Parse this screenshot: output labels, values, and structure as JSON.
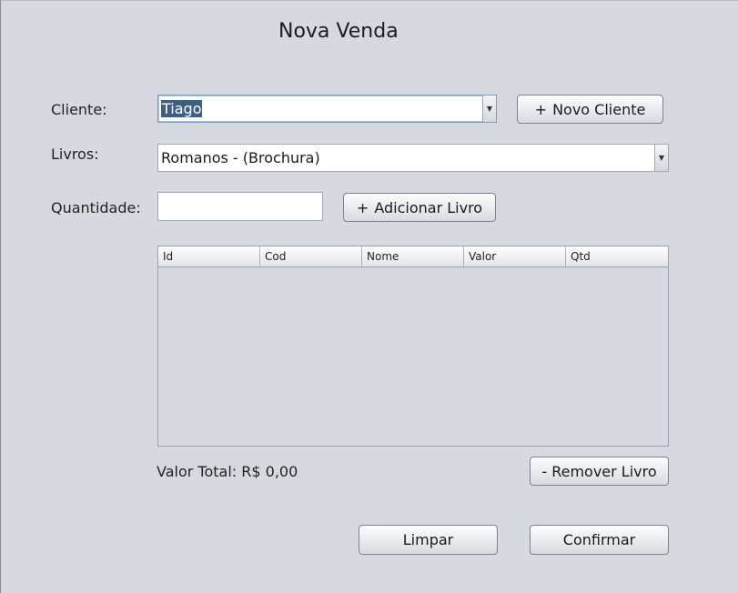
{
  "window": {
    "title": "Nova Venda"
  },
  "cliente": {
    "label": "Cliente:",
    "selected": "Tiago",
    "new_button": "Novo Cliente"
  },
  "livros": {
    "label": "Livros:",
    "selected": "Romanos - (Brochura)"
  },
  "quantidade": {
    "label": "Quantidade:",
    "value": "",
    "add_button": "Adicionar Livro"
  },
  "table": {
    "columns": [
      "Id",
      "Cod",
      "Nome",
      "Valor",
      "Qtd"
    ],
    "rows": []
  },
  "summary": {
    "total_label": "Valor Total: R$ 0,00",
    "remove_button": "- Remover Livro"
  },
  "actions": {
    "clear_button": "Limpar",
    "confirm_button": "Confirmar"
  },
  "icons": {
    "combo_arrow": "chevron-down-icon",
    "plus": "plus-icon"
  }
}
